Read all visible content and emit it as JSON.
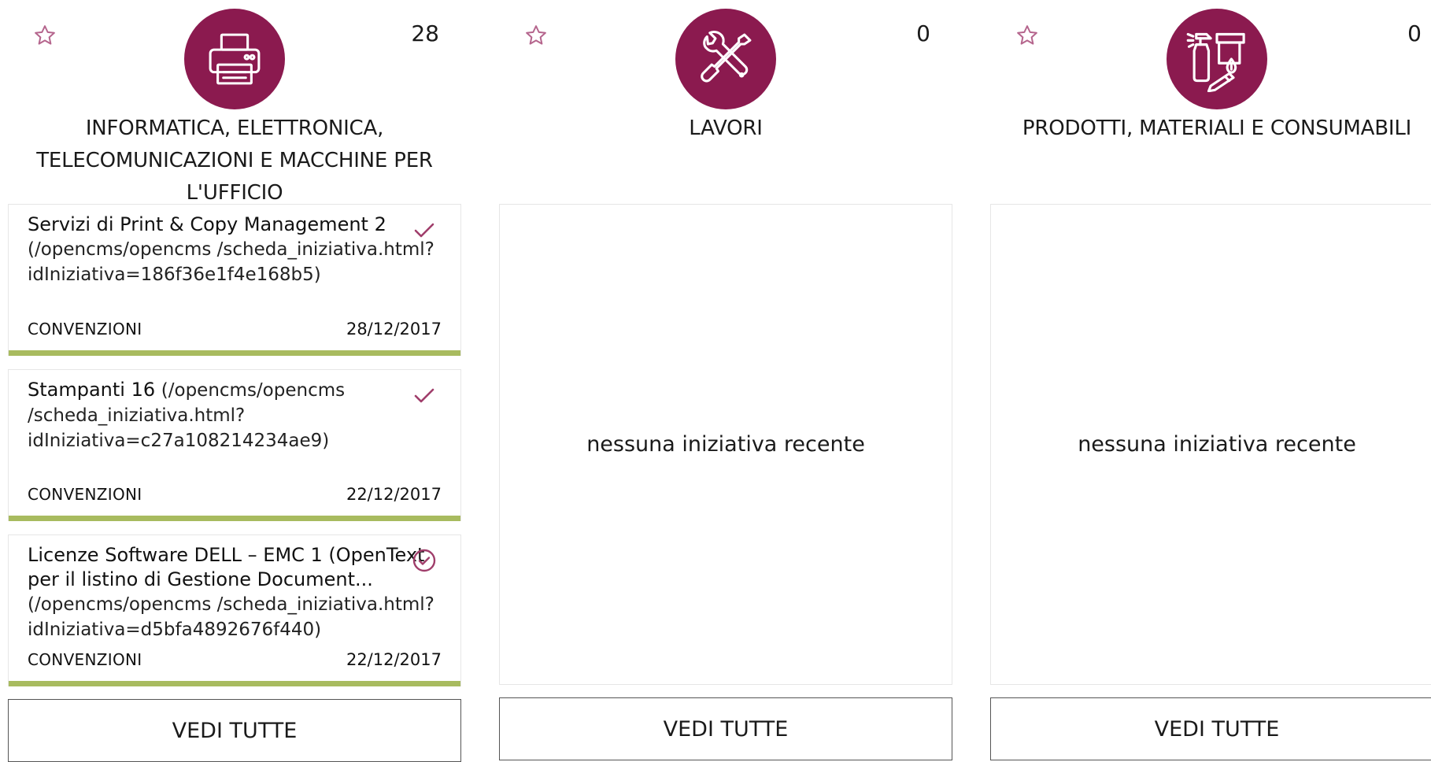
{
  "colors": {
    "accent": "#8b1a4f",
    "card_bar": "#a8bb5f",
    "border": "#e6e6e6"
  },
  "columns": [
    {
      "icon": "printer-icon",
      "count": "28",
      "title": "INFORMATICA, ELETTRONICA, TELECOMUNICAZIONI E MACCHINE PER L'UFFICIO",
      "items": [
        {
          "title": "Servizi di Print & Copy Management 2",
          "path": "(/opencms/opencms /scheda_iniziativa.html?idIniziativa=186f36e1f4e168b5)",
          "type": "CONVENZIONI",
          "date": "28/12/2017",
          "status_icon": "check-icon"
        },
        {
          "title": "Stampanti 16",
          "path": "(/opencms/opencms /scheda_iniziativa.html?idIniziativa=c27a108214234ae9)",
          "type": "CONVENZIONI",
          "date": "22/12/2017",
          "status_icon": "check-icon"
        },
        {
          "title": "Licenze Software DELL – EMC 1 (OpenText per il listino di Gestione Document...",
          "path": "(/opencms/opencms /scheda_iniziativa.html?idIniziativa=d5bfa4892676f440)",
          "type": "CONVENZIONI",
          "date": "22/12/2017",
          "status_icon": "check-circle-icon"
        }
      ],
      "button": "VEDI TUTTE"
    },
    {
      "icon": "tools-icon",
      "count": "0",
      "title": "LAVORI",
      "empty_text": "nessuna iniziativa recente",
      "button": "VEDI TUTTE"
    },
    {
      "icon": "cleaning-supplies-icon",
      "count": "0",
      "title": "PRODOTTI, MATERIALI E CONSUMABILI",
      "empty_text": "nessuna iniziativa recente",
      "button": "VEDI TUTTE"
    }
  ]
}
